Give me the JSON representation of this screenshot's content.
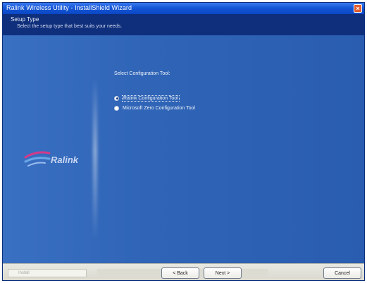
{
  "window": {
    "title": "Ralink Wireless Utility - InstallShield Wizard",
    "close_glyph": "×"
  },
  "header": {
    "title": "Setup Type",
    "subtitle": "Select the setup type that best suits your needs."
  },
  "content": {
    "config_tool_label": "Select Configuration Tool:",
    "options": [
      {
        "label": "Ralink Configuration Tool",
        "checked": true
      },
      {
        "label": "Microsoft Zero Configuration Tool",
        "checked": false
      }
    ]
  },
  "logo": {
    "text": "Ralink",
    "colors": {
      "stripe_1": "#d33a8a",
      "stripe_2": "#6aa7e8"
    }
  },
  "footer": {
    "brand_text": "Install",
    "back_label": "< Back",
    "next_label": "Next >",
    "cancel_label": "Cancel"
  }
}
